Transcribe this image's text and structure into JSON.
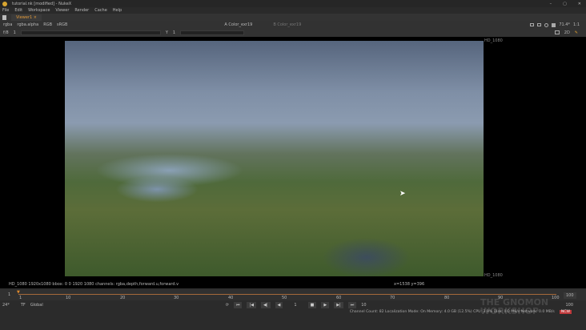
{
  "window": {
    "title": "tutorial.nk [modified] - NukeX",
    "controls": [
      "–",
      "▢",
      "✕"
    ]
  },
  "menu": [
    "File",
    "Edit",
    "Workspace",
    "Viewer",
    "Render",
    "Cache",
    "Help"
  ],
  "tab": {
    "label": "Viewer1",
    "close": "×"
  },
  "toolbar": {
    "layer": "rgba",
    "alpha": "rgba.alpha",
    "display": "RGB",
    "lut": "sRGB",
    "input_a": "A  Color_exr19",
    "input_b": "B  Color_exr19",
    "zoom": "71.4*",
    "ratio": "1:1",
    "gain": "f/8",
    "gain_val": "1",
    "gamma_label": "Y",
    "gamma_val": "1",
    "view_mode": "2D"
  },
  "viewer": {
    "format_top": "HD_1080",
    "format_bottom": "HD_1080",
    "info": "HD_1080 1920x1080  bbox: 0 0 1920 1080 channels: rgba,depth,forward.u,forward.v",
    "coords": "x=1538 y=396"
  },
  "timeline": {
    "ticks": [
      "1",
      "10",
      "20",
      "30",
      "40",
      "50",
      "60",
      "70",
      "80",
      "90",
      "100"
    ],
    "start": "1",
    "end": "100",
    "end_field": "100",
    "fps": "24*",
    "tf": "TF",
    "scope": "Global",
    "frame": "1",
    "inc": "10"
  },
  "status": {
    "text": "Channel Count: 82 Localization Mode: On Memory: 4.0 GB (12.5%) CPU: 3.9% Disk: 0.0 MB/s Network: 0.0 MB/s",
    "badge": "NCW"
  },
  "watermark": "THE GNOMON WORKSHOP"
}
